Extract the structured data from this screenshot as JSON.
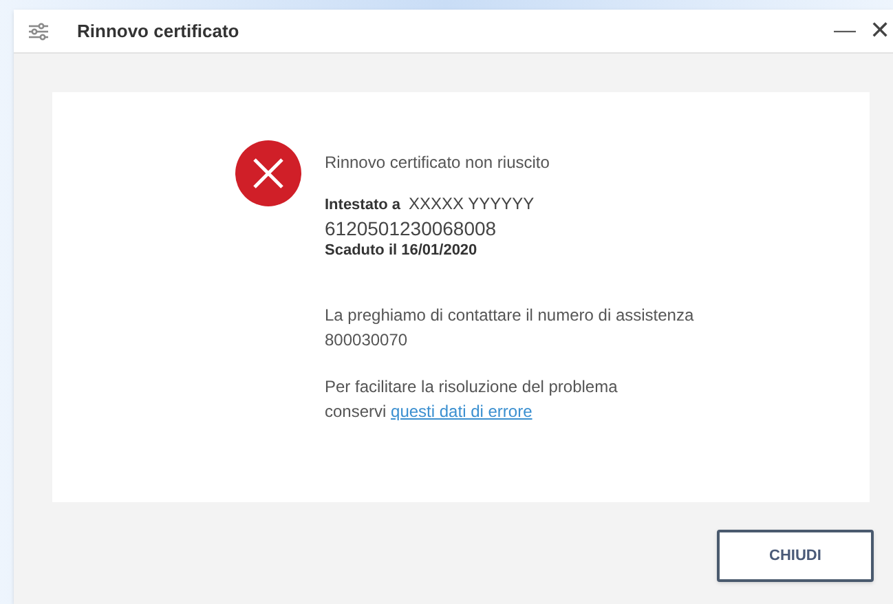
{
  "window": {
    "title": "Rinnovo certificato",
    "minimize": "—",
    "close": "✕"
  },
  "message": {
    "title": "Rinnovo certificato non riuscito",
    "holder_label": "Intestato a",
    "holder_value": "XXXXX YYYYYY",
    "serial": "6120501230068008",
    "expiry": "Scaduto il 16/01/2020",
    "assistance": "La preghiamo di contattare il numero di assistenza",
    "phone": "800030070",
    "help_prefix": "Per facilitare la risoluzione del problema conservi",
    "help_link": "questi dati di errore"
  },
  "buttons": [
    "CHIUDI"
  ]
}
